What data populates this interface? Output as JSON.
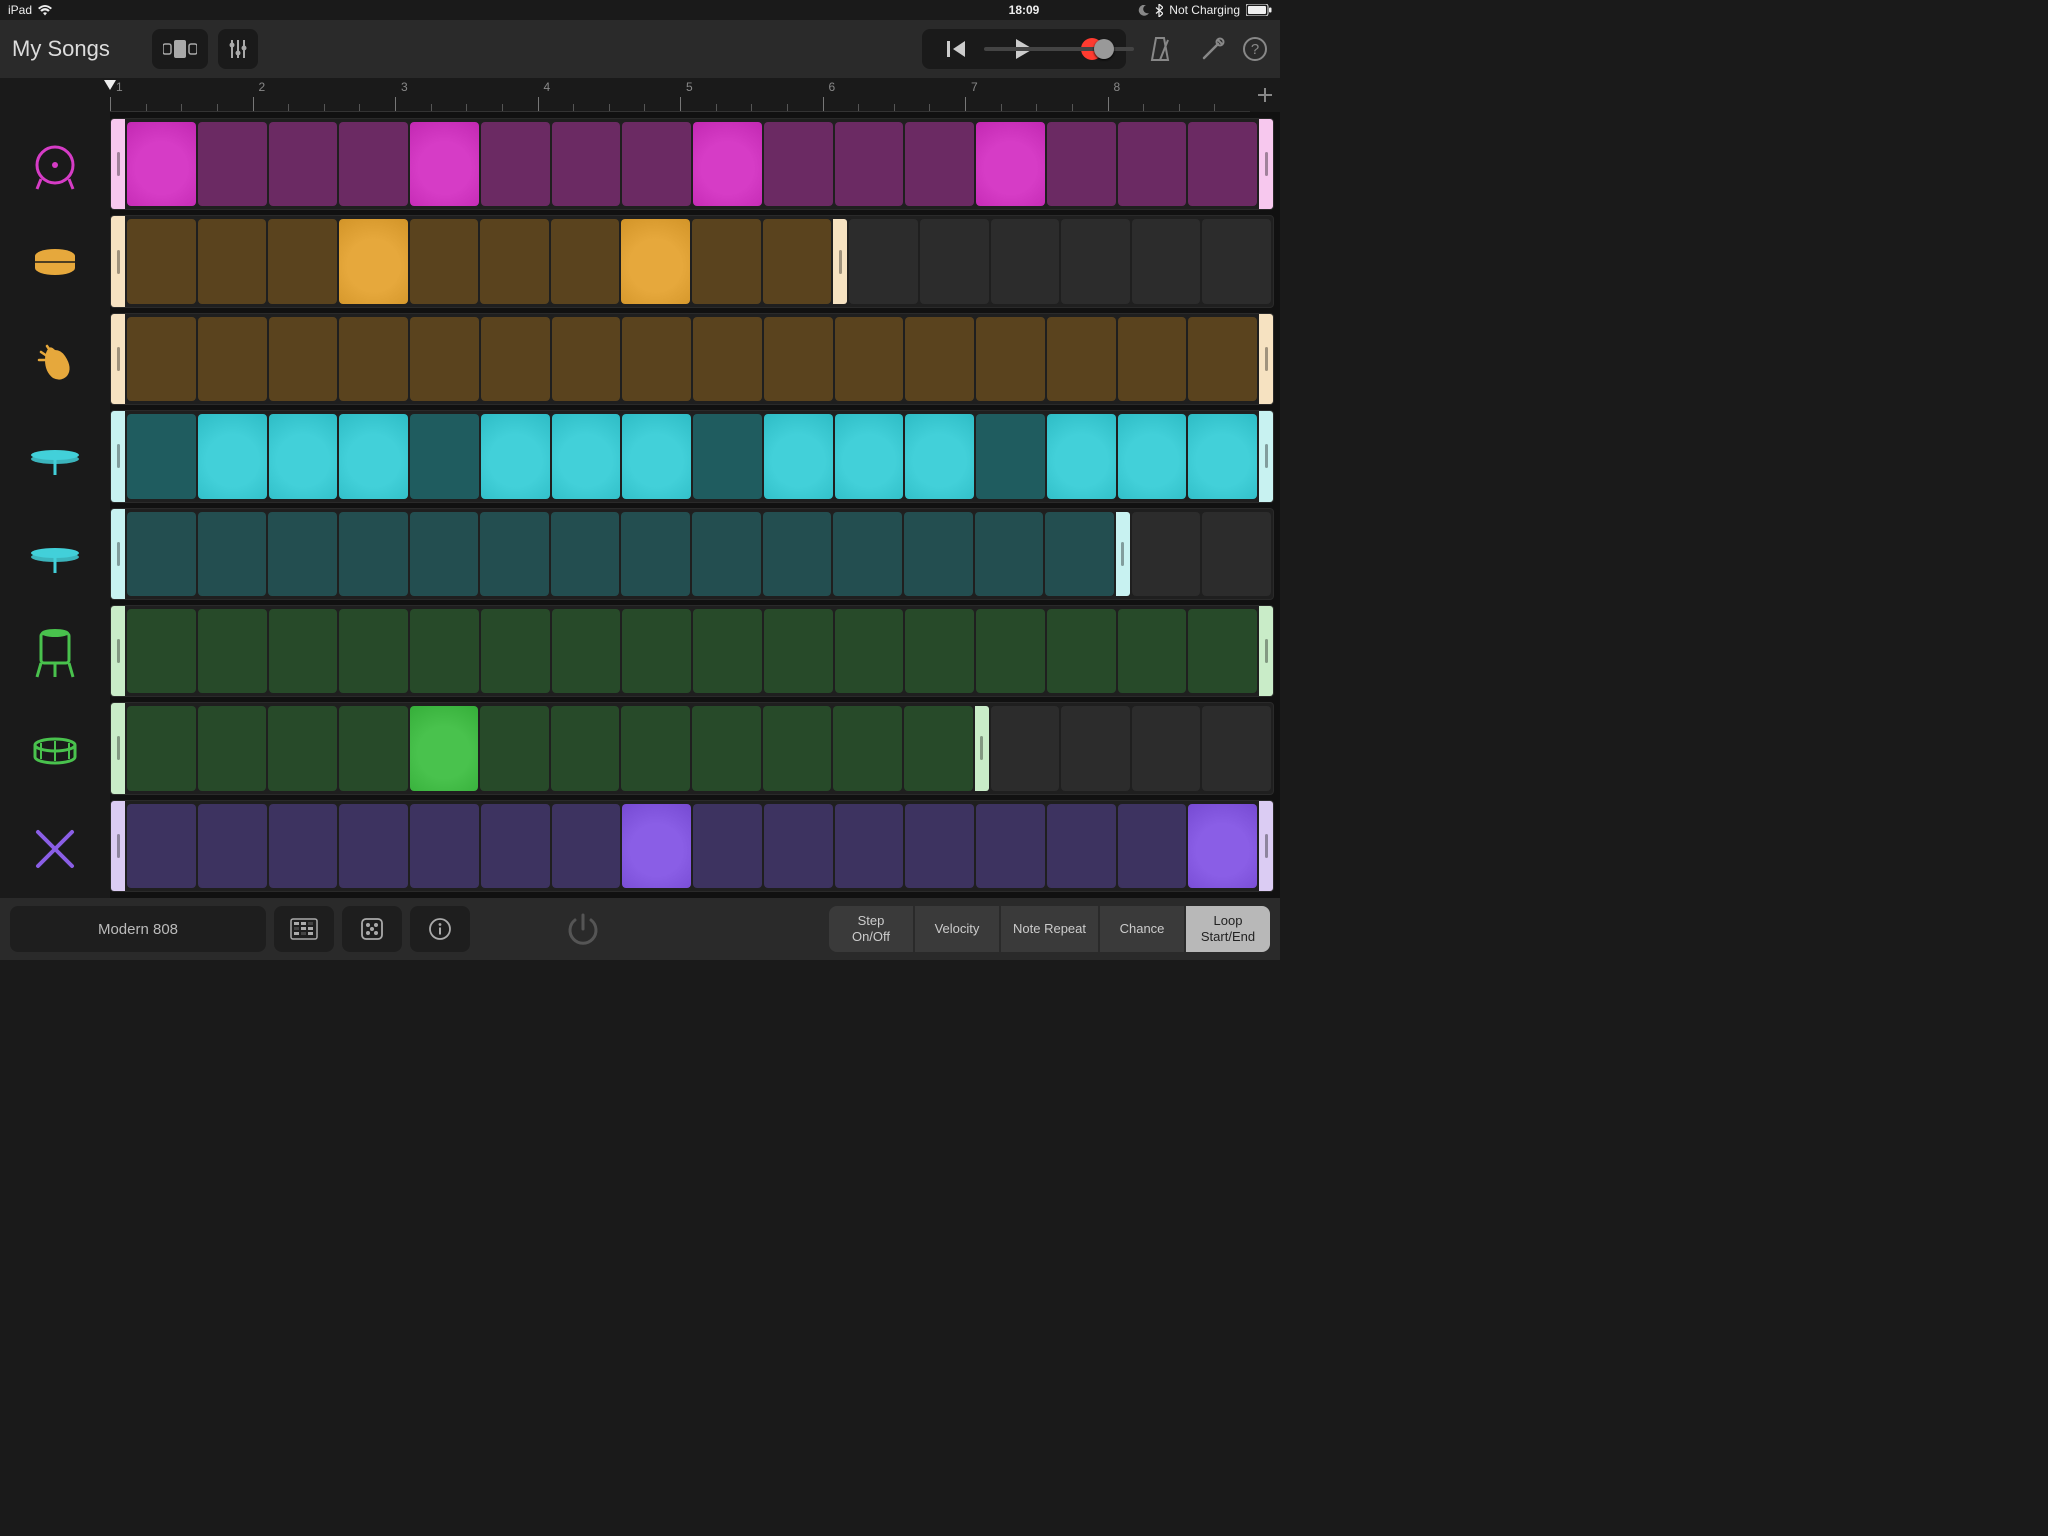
{
  "status": {
    "device": "iPad",
    "time": "18:09",
    "charging_label": "Not Charging"
  },
  "header": {
    "title": "My Songs"
  },
  "ruler": {
    "bars": [
      "1",
      "2",
      "3",
      "4",
      "5",
      "6",
      "7",
      "8"
    ]
  },
  "tracks": [
    {
      "name": "kick",
      "color": "#d63cc6",
      "dim": "#6b2a63",
      "light": "#f3b8ea",
      "handle": "#f7c8ee",
      "steps": 16,
      "loopEnd": 16,
      "active": [
        0,
        4,
        8,
        12
      ],
      "pattern_label": "kick-pattern"
    },
    {
      "name": "snare",
      "color": "#e6a83c",
      "dim": "#5a431e",
      "light": "#f4debb",
      "handle": "#f6e2c1",
      "steps": 16,
      "loopEnd": 10,
      "active": [
        3,
        7
      ],
      "pattern_label": "snare-pattern"
    },
    {
      "name": "clap",
      "color": "#e6a83c",
      "dim": "#5a431e",
      "light": "#f4debb",
      "handle": "#f6e2c1",
      "steps": 16,
      "loopEnd": 16,
      "active": [],
      "pattern_label": "clap-pattern"
    },
    {
      "name": "closed-hat",
      "color": "#42d0d9",
      "dim": "#1f5c5f",
      "light": "#c3efee",
      "handle": "#c8f2f1",
      "steps": 16,
      "loopEnd": 16,
      "active": [
        1,
        2,
        3,
        5,
        6,
        7,
        9,
        10,
        11,
        13,
        14,
        15
      ],
      "pattern_label": "closed-hat-pattern"
    },
    {
      "name": "open-hat",
      "color": "#42d0d9",
      "dim": "#234e50",
      "light": "#c3efee",
      "handle": "#c8f2f1",
      "steps": 16,
      "loopEnd": 14,
      "active": [],
      "pattern_label": "open-hat-pattern"
    },
    {
      "name": "tom",
      "color": "#49c24d",
      "dim": "#274a29",
      "light": "#c6e9c5",
      "handle": "#c9ecc8",
      "steps": 16,
      "loopEnd": 16,
      "active": [],
      "pattern_label": "tom-pattern"
    },
    {
      "name": "rim",
      "color": "#49c24d",
      "dim": "#274a29",
      "light": "#c6e9c5",
      "handle": "#c9ecc8",
      "steps": 16,
      "loopEnd": 12,
      "active": [
        4
      ],
      "pattern_label": "rim-pattern"
    },
    {
      "name": "sticks",
      "color": "#8a5ee6",
      "dim": "#3d3360",
      "light": "#d8c8f1",
      "handle": "#dbccf3",
      "steps": 16,
      "loopEnd": 16,
      "active": [
        7,
        15
      ],
      "pattern_label": "sticks-pattern"
    }
  ],
  "bottom": {
    "kit": "Modern 808",
    "params": [
      {
        "id": "step-onoff",
        "line1": "Step",
        "line2": "On/Off"
      },
      {
        "id": "velocity",
        "line1": "Velocity",
        "line2": ""
      },
      {
        "id": "note-repeat",
        "line1": "Note Repeat",
        "line2": ""
      },
      {
        "id": "chance",
        "line1": "Chance",
        "line2": ""
      },
      {
        "id": "loop",
        "line1": "Loop",
        "line2": "Start/End",
        "active": true
      }
    ]
  }
}
